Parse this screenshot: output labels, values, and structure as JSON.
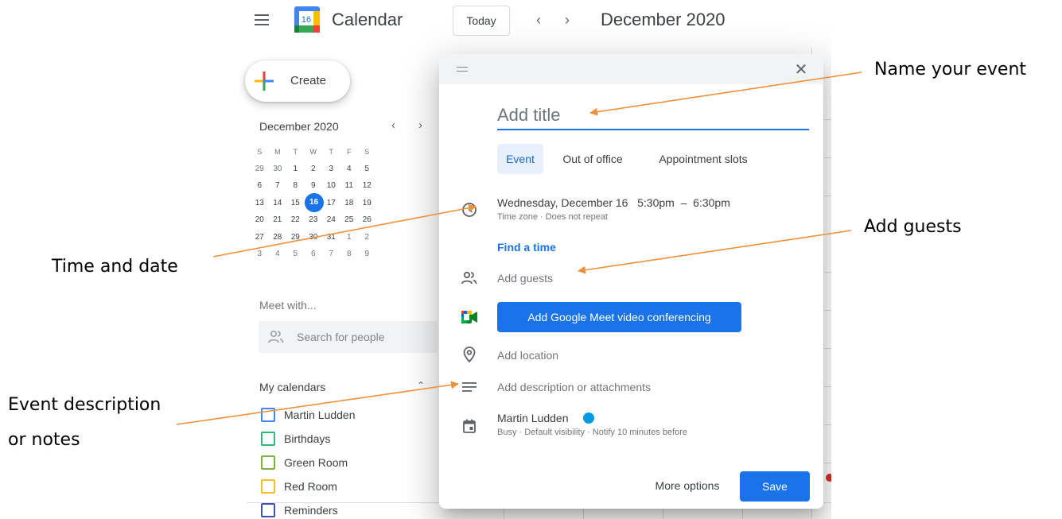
{
  "app": {
    "name": "Calendar",
    "logo_day": "16",
    "today_label": "Today",
    "current_month": "December 2020",
    "create_label": "Create"
  },
  "mini_calendar": {
    "title": "December 2020",
    "weekdays": [
      "S",
      "M",
      "T",
      "W",
      "T",
      "F",
      "S"
    ],
    "weeks": [
      [
        "29",
        "30",
        "1",
        "2",
        "3",
        "4",
        "5"
      ],
      [
        "6",
        "7",
        "8",
        "9",
        "10",
        "11",
        "12"
      ],
      [
        "13",
        "14",
        "15",
        "16",
        "17",
        "18",
        "19"
      ],
      [
        "20",
        "21",
        "22",
        "23",
        "24",
        "25",
        "26"
      ],
      [
        "27",
        "28",
        "29",
        "30",
        "31",
        "1",
        "2"
      ],
      [
        "3",
        "4",
        "5",
        "6",
        "7",
        "8",
        "9"
      ]
    ],
    "today": "16"
  },
  "sidebar": {
    "meet_with": "Meet with...",
    "search_placeholder": "Search for people",
    "my_calendars_label": "My calendars",
    "calendars": [
      {
        "name": "Martin Ludden",
        "color": "#4285f4"
      },
      {
        "name": "Birthdays",
        "color": "#33b679"
      },
      {
        "name": "Green Room",
        "color": "#7cb342"
      },
      {
        "name": "Red Room",
        "color": "#f6bf26"
      },
      {
        "name": "Reminders",
        "color": "#3f51b5"
      }
    ]
  },
  "dialog": {
    "title_placeholder": "Add title",
    "tabs": [
      {
        "label": "Event",
        "active": true
      },
      {
        "label": "Out of office",
        "active": false
      },
      {
        "label": "Appointment slots",
        "active": false
      }
    ],
    "date_time": "Wednesday, December 16   5:30pm  –  6:30pm",
    "date_sub": "Time zone · Does not repeat",
    "find_time": "Find a time",
    "add_guests": "Add guests",
    "meet_button": "Add Google Meet video conferencing",
    "add_location": "Add location",
    "add_description": "Add description or attachments",
    "owner": "Martin Ludden",
    "owner_sub": "Busy · Default visibility · Notify 10 minutes before",
    "more_options": "More options",
    "save": "Save"
  },
  "annotations": {
    "name_event": "Name your event",
    "add_guests": "Add guests",
    "time_and_date": "Time and date",
    "event_description_line1": "Event description",
    "event_description_line2": "or notes",
    "arrow_color": "#f0913a"
  },
  "colors": {
    "accent": "#1a73e8",
    "today_circle": "#1a73e8",
    "owner_dot": "#039be5",
    "arrow": "#f0913a"
  }
}
